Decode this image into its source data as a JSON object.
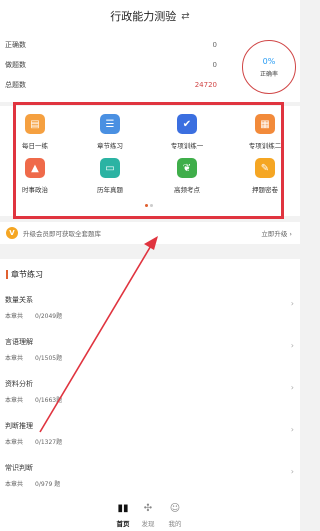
{
  "header": {
    "title": "行政能力测验",
    "swap_icon": "swap-arrows-icon"
  },
  "stats": {
    "correct_label": "正确数",
    "correct_value": "0",
    "done_label": "做题数",
    "done_value": "0",
    "total_label": "总题数",
    "total_value": "24720",
    "rate_value": "0%",
    "rate_label": "正确率"
  },
  "tiles": [
    {
      "label": "每日一练",
      "color": "#f5a040",
      "icon": "calendar-icon"
    },
    {
      "label": "章节练习",
      "color": "#4a90e2",
      "icon": "list-icon"
    },
    {
      "label": "专项训练一",
      "color": "#3b6fe0",
      "icon": "check-list-icon"
    },
    {
      "label": "专项训练二",
      "color": "#f28a3a",
      "icon": "grid-icon"
    },
    {
      "label": "时事政治",
      "color": "#ef6a4a",
      "icon": "hat-icon"
    },
    {
      "label": "历年真题",
      "color": "#2bb3a3",
      "icon": "monitor-icon"
    },
    {
      "label": "高频考点",
      "color": "#3fae4a",
      "icon": "leaf-icon"
    },
    {
      "label": "押题密卷",
      "color": "#f5a623",
      "icon": "note-icon"
    }
  ],
  "promo": {
    "badge": "V",
    "text": "升级会员即可获取全套题库",
    "link": "立即升级 ›"
  },
  "chapter": {
    "title": "章节练习",
    "items": [
      {
        "name": "数量关系",
        "prefix": "本章共",
        "count": "0/2049题"
      },
      {
        "name": "言语理解",
        "prefix": "本章共",
        "count": "0/1505题"
      },
      {
        "name": "资料分析",
        "prefix": "本章共",
        "count": "0/1663题"
      },
      {
        "name": "判断推理",
        "prefix": "本章共",
        "count": "0/1327题"
      },
      {
        "name": "常识判断",
        "prefix": "本章共",
        "count": "0/979 题"
      }
    ]
  },
  "tabbar": [
    {
      "label": "首页",
      "icon": "home-icon"
    },
    {
      "label": "发现",
      "icon": "discover-icon"
    },
    {
      "label": "我的",
      "icon": "profile-icon"
    }
  ],
  "colors": {
    "accent": "#e0343f",
    "ring": "#d04545",
    "link_blue": "#2a9df4"
  }
}
